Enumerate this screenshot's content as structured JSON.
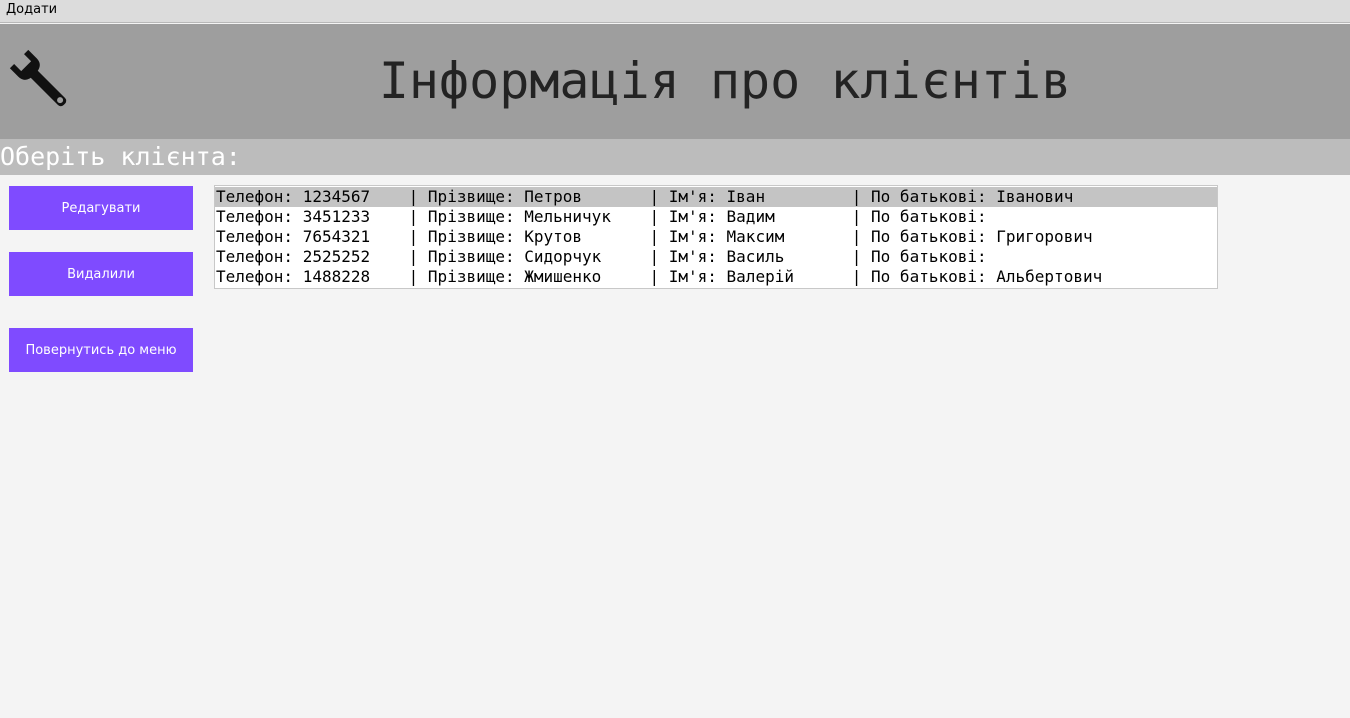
{
  "menubar": {
    "items": [
      "Додати"
    ]
  },
  "header": {
    "icon": "wrench-icon",
    "title": "Інформація про клієнтів"
  },
  "subheader": {
    "title": "Оберіть клієнта:"
  },
  "buttons": {
    "edit_label": "Редагувати",
    "delete_label": "Видалили",
    "back_label": "Повернутись до меню"
  },
  "client_list": {
    "selected_index": 0,
    "rows": [
      "Телефон: 1234567    | Прізвище: Петров       | Ім'я: Іван         | По батькові: Іванович",
      "Телефон: 3451233    | Прізвище: Мельничук    | Ім'я: Вадим        | По батькові:",
      "Телефон: 7654321    | Прізвище: Крутов       | Ім'я: Максим       | По батькові: Григорович",
      "Телефон: 2525252    | Прізвище: Сидорчук     | Ім'я: Василь       | По батькові:",
      "Телефон: 1488228    | Прізвище: Жмишенко     | Ім'я: Валерій      | По батькові: Альбертович"
    ]
  },
  "colors": {
    "button_bg": "#7f4bff",
    "header_bg": "#9e9e9e",
    "subheader_bg": "#bcbcbc",
    "selected_row_bg": "#c4c4c4"
  }
}
